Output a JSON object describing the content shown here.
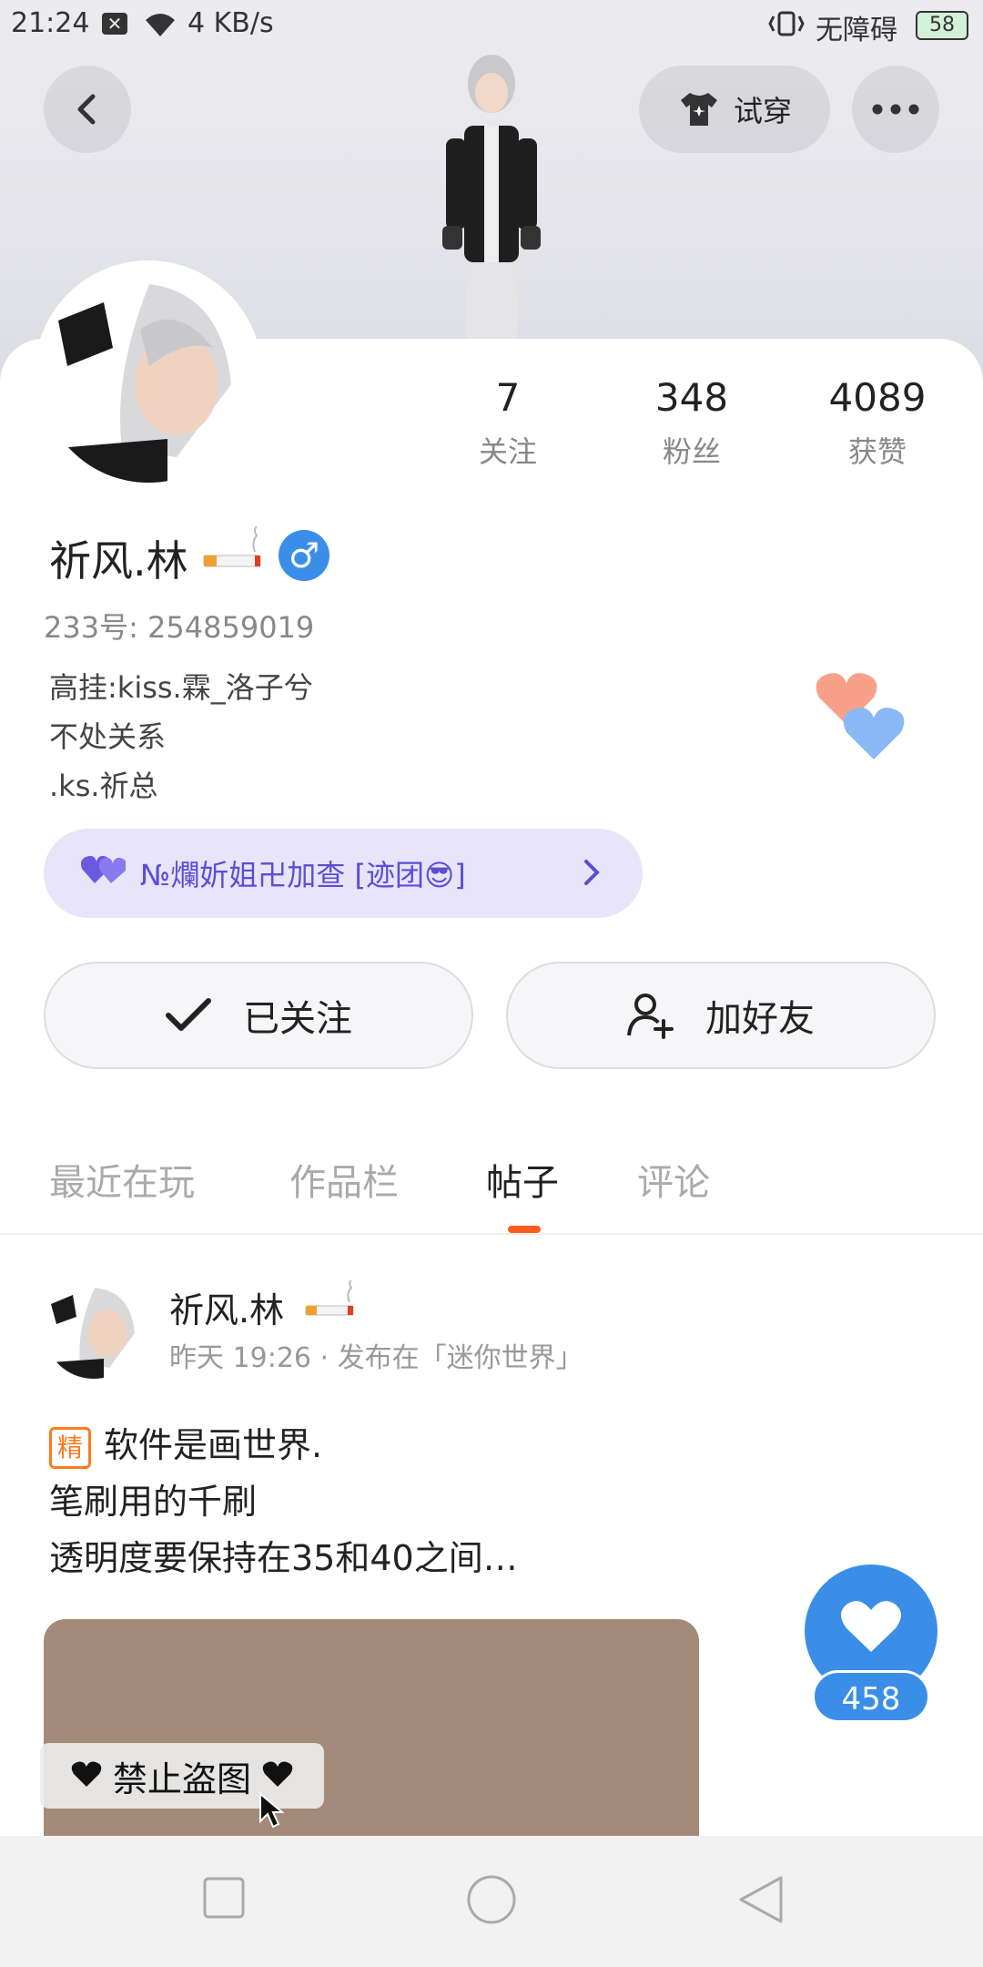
{
  "status_bar": {
    "time": "21:24",
    "x_icon": "✕",
    "speed": "4 KB/s",
    "accessibility": "无障碍",
    "battery": "58"
  },
  "header": {
    "tryon_label": "试穿"
  },
  "stats": [
    {
      "value": "7",
      "label": "关注"
    },
    {
      "value": "348",
      "label": "粉丝"
    },
    {
      "value": "4089",
      "label": "获赞"
    }
  ],
  "profile": {
    "name": "祈风.林",
    "gender_symbol": "♂",
    "uid": "233号: 254859019",
    "bio": [
      "高挂:kiss.霖_洛子兮",
      "不处关系",
      ".ks.祈总"
    ]
  },
  "group": {
    "label": "№爛妡姐卍加查 [迹团😎]"
  },
  "actions": {
    "follow_label": "已关注",
    "add_friend_label": "加好友"
  },
  "tabs": [
    {
      "label": "最近在玩"
    },
    {
      "label": "作品栏"
    },
    {
      "label": "帖子"
    },
    {
      "label": "评论"
    }
  ],
  "post": {
    "author": "祈风.林",
    "meta": "昨天 19:26 · 发布在「迷你世界」",
    "badge": "精",
    "lines": [
      "软件是画世界.",
      "笔刷用的千刷",
      "透明度要保持在35和40之间…"
    ],
    "watermark": "禁止盗图",
    "likes": "458"
  },
  "colors": {
    "accent_blue": "#3a8ee8",
    "tab_indicator": "#ff5a1f",
    "group_bg": "#e8e4fa",
    "group_text": "#5a4ed6"
  }
}
